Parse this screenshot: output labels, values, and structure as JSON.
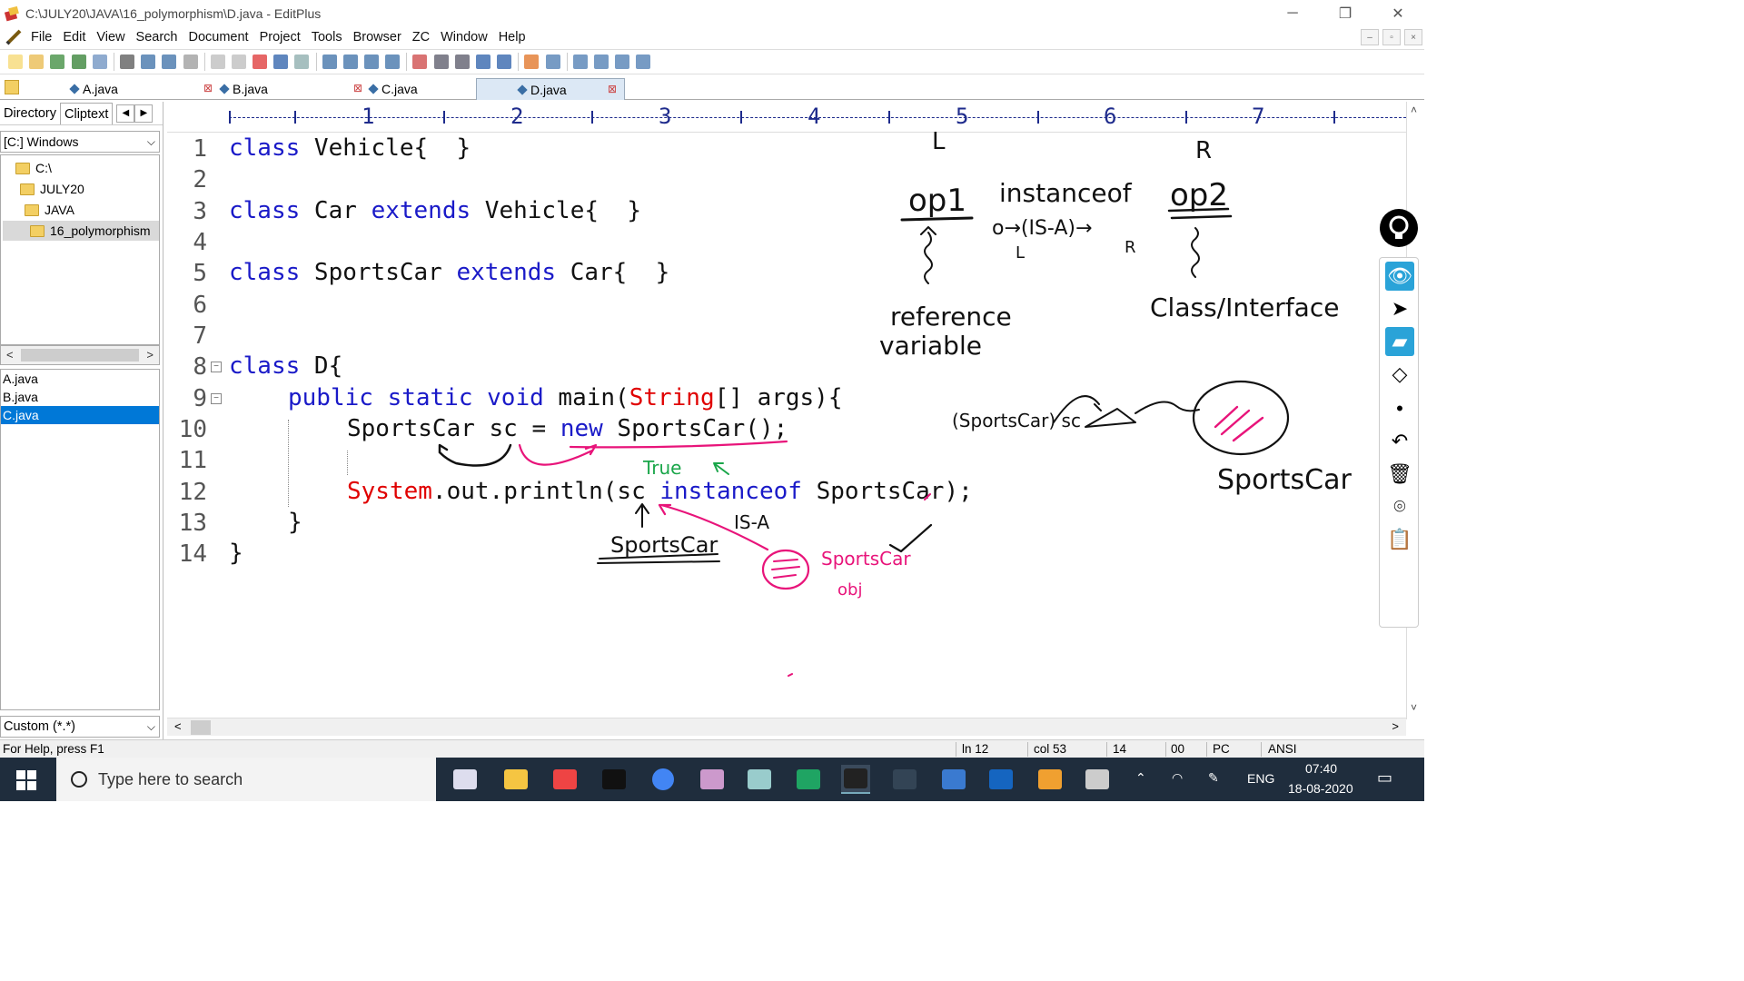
{
  "window": {
    "title": "C:\\JULY20\\JAVA\\16_polymorphism\\D.java - EditPlus",
    "controls": {
      "minimize": "─",
      "maximize": "❐",
      "close": "✕"
    },
    "mdi": {
      "minimize": "–",
      "restore": "▫",
      "close": "×"
    }
  },
  "menu": [
    "File",
    "Edit",
    "View",
    "Search",
    "Document",
    "Project",
    "Tools",
    "Browser",
    "ZC",
    "Window",
    "Help"
  ],
  "toolbar_icons": [
    "new-file-icon",
    "open-icon",
    "save-icon",
    "save-all-icon",
    "print-preview-icon",
    "print-icon",
    "spellcheck-icon",
    "sync-icon",
    "cut-icon",
    "copy-icon",
    "paste-icon",
    "delete-icon",
    "undo-icon",
    "redo-icon",
    "find-icon",
    "replace-icon",
    "find-in-files-icon",
    "goto-icon",
    "font-icon",
    "hex-icon",
    "word-wrap-icon",
    "line-number-icon",
    "abcd-icon",
    "check-icon",
    "browser-icon",
    "split-icon",
    "preview-icon",
    "fullscreen-icon",
    "help-icon"
  ],
  "tabs": [
    {
      "label": "A.java",
      "active": false
    },
    {
      "label": "B.java",
      "active": false
    },
    {
      "label": "C.java",
      "active": false
    },
    {
      "label": "D.java",
      "active": true
    }
  ],
  "sidebar": {
    "tabs": [
      "Directory",
      "Cliptext"
    ],
    "arrows": {
      "left": "◀",
      "right": "▶"
    },
    "drive": "[C:] Windows",
    "tree": [
      "C:\\",
      "JULY20",
      "JAVA",
      "16_polymorphism"
    ],
    "scroll": {
      "left": "<",
      "right": ">"
    },
    "files": [
      {
        "name": "A.java",
        "selected": false
      },
      {
        "name": "B.java",
        "selected": false
      },
      {
        "name": "C.java",
        "selected": true
      }
    ],
    "filter": "Custom (*.*)"
  },
  "ruler": [
    "1",
    "2",
    "3",
    "4",
    "5",
    "6",
    "7"
  ],
  "line_numbers": [
    "1",
    "2",
    "3",
    "4",
    "5",
    "6",
    "7",
    "8",
    "9",
    "10",
    "11",
    "12",
    "13",
    "14"
  ],
  "code": {
    "l1_kw": "class",
    "l1_rest": " Vehicle{  }",
    "l3_kw": "class",
    "l3_a": " Car ",
    "l3_kw2": "extends",
    "l3_b": " Vehicle{  }",
    "l5_kw": "class",
    "l5_a": " SportsCar ",
    "l5_kw2": "extends",
    "l5_b": " Car{  }",
    "l8_kw": "class",
    "l8_rest": " D{",
    "l9_kw": "public static void",
    "l9_a": " main(",
    "l9_str": "String",
    "l9_b": "[] args){",
    "l10_a": "SportsCar sc = ",
    "l10_kw": "new",
    "l10_b": " SportsCar();",
    "l12_str": "System",
    "l12_a": ".out.println(sc ",
    "l12_kw": "instanceof",
    "l12_b": " SportsCar);",
    "l13": "}",
    "l14": "}"
  },
  "annotations": {
    "L_top": "L",
    "R_top": "R",
    "op1": "op1",
    "instanceof": "instanceof",
    "op2": "op2",
    "isa": "o→(IS-A)→",
    "L_small": "L",
    "R_small": "R",
    "reference": "reference",
    "variable": "variable",
    "class_interface": "Class/Interface",
    "cast_sc": "(SportsCar) sc",
    "sportscar_right": "SportsCar",
    "true_label": "True",
    "isa_label": "IS-A",
    "sportscar_under": "SportsCar",
    "sportscar_pink": "SportsCar",
    "obj_pink": "obj"
  },
  "statusbar": {
    "help": "For Help, press F1",
    "ln": "ln 12",
    "col": "col 53",
    "lines": "14",
    "hex": "00",
    "mode": "PC",
    "enc": "ANSI"
  },
  "taskbar": {
    "search_placeholder": "Type here to search",
    "lang": "ENG",
    "time": "07:40",
    "date": "18-08-2020",
    "apps": [
      "task-view-icon",
      "file-explorer-icon",
      "editplus-icon",
      "terminal-icon",
      "chrome-icon",
      "pen-tool-icon",
      "notepad-icon",
      "google-drive-icon",
      "epic-pen-icon",
      "mysql-icon",
      "photos-icon",
      "whiteboard-icon",
      "paint-icon",
      "monitor-icon"
    ]
  },
  "pen_tools": [
    "eye-icon",
    "cursor-icon",
    "highlighter-icon",
    "eraser-icon",
    "dot-icon",
    "undo-icon",
    "trash-icon",
    "camera-icon",
    "clipboard-icon",
    "color-palette-icon"
  ],
  "colors": {
    "keyword": "#1a1ac8",
    "string": "#e00000",
    "ink_black": "#111111",
    "ink_pink": "#e8147a",
    "ink_green": "#1aa64a",
    "selection": "#0078d7"
  }
}
